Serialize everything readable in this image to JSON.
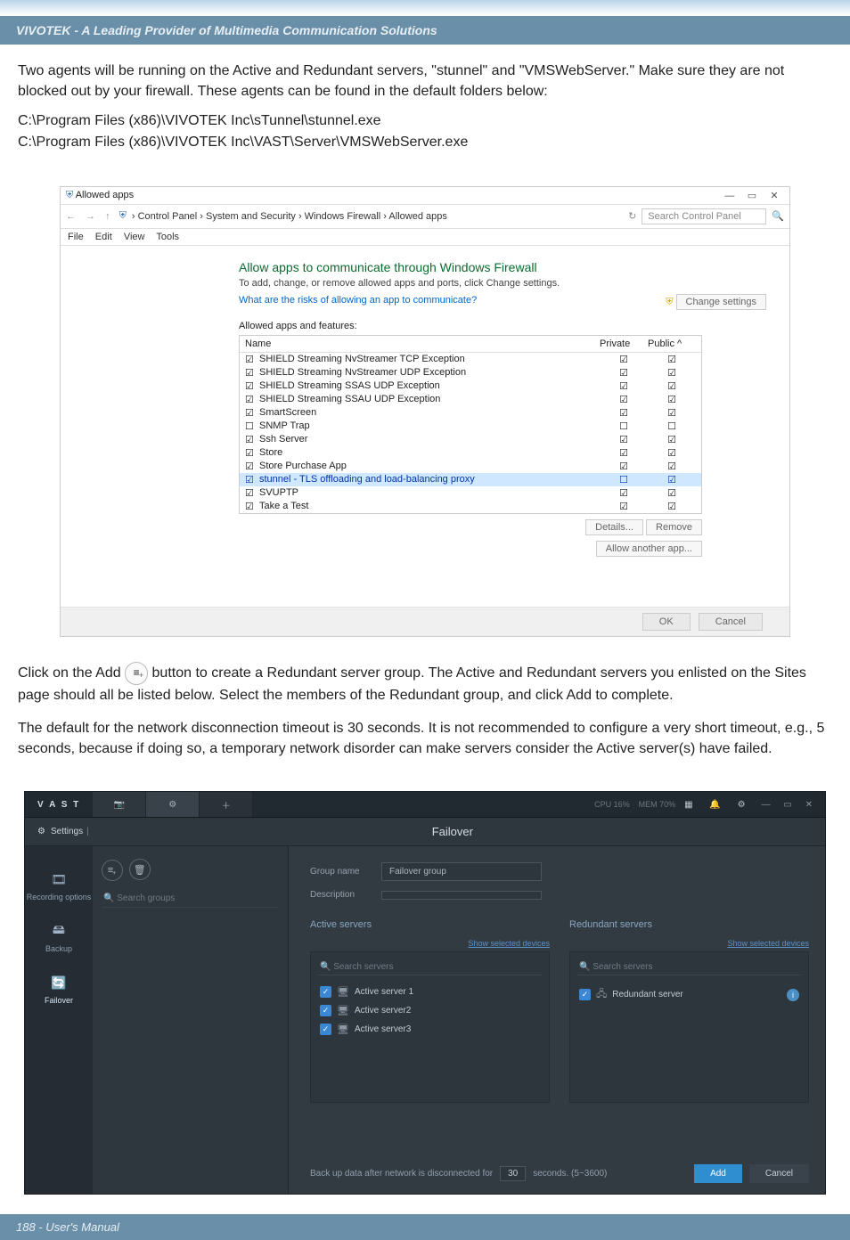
{
  "header": {
    "banner": "VIVOTEK - A Leading Provider of Multimedia Communication Solutions"
  },
  "intro": {
    "para1": "Two agents will be running on the Active and Redundant servers, \"stunnel\" and \"VMSWebServer.\" Make sure they are not blocked out by your firewall. These agents can be found in the default folders below:",
    "path1": "C:\\Program Files (x86)\\VIVOTEK Inc\\sTunnel\\stunnel.exe",
    "path2": "C:\\Program Files (x86)\\VIVOTEK Inc\\VAST\\Server\\VMSWebServer.exe"
  },
  "firewall": {
    "windowTitle": "Allowed apps",
    "breadcrumbs": "› Control Panel › System and Security › Windows Firewall › Allowed apps",
    "searchPlaceholder": "Search Control Panel",
    "menus": [
      "File",
      "Edit",
      "View",
      "Tools"
    ],
    "heading": "Allow apps to communicate through Windows Firewall",
    "subheading": "To add, change, or remove allowed apps and ports, click Change settings.",
    "risksLink": "What are the risks of allowing an app to communicate?",
    "changeSettings": "Change settings",
    "listLabel": "Allowed apps and features:",
    "colName": "Name",
    "colPrivate": "Private",
    "colPublic": "Public",
    "rows": [
      {
        "checked": true,
        "name": "SHIELD Streaming NvStreamer TCP Exception",
        "private": true,
        "public": true,
        "hl": false
      },
      {
        "checked": true,
        "name": "SHIELD Streaming NvStreamer UDP Exception",
        "private": true,
        "public": true,
        "hl": false
      },
      {
        "checked": true,
        "name": "SHIELD Streaming SSAS UDP Exception",
        "private": true,
        "public": true,
        "hl": false
      },
      {
        "checked": true,
        "name": "SHIELD Streaming SSAU UDP Exception",
        "private": true,
        "public": true,
        "hl": false
      },
      {
        "checked": true,
        "name": "SmartScreen",
        "private": true,
        "public": true,
        "hl": false
      },
      {
        "checked": false,
        "name": "SNMP Trap",
        "private": false,
        "public": false,
        "hl": false
      },
      {
        "checked": true,
        "name": "Ssh Server",
        "private": true,
        "public": true,
        "hl": false
      },
      {
        "checked": true,
        "name": "Store",
        "private": true,
        "public": true,
        "hl": false
      },
      {
        "checked": true,
        "name": "Store Purchase App",
        "private": true,
        "public": true,
        "hl": false
      },
      {
        "checked": true,
        "name": "stunnel - TLS offloading and load-balancing proxy",
        "private": false,
        "public": true,
        "hl": true
      },
      {
        "checked": true,
        "name": "SVUPTP",
        "private": true,
        "public": true,
        "hl": false
      },
      {
        "checked": true,
        "name": "Take a Test",
        "private": true,
        "public": true,
        "hl": false
      }
    ],
    "detailsBtn": "Details...",
    "removeBtn": "Remove",
    "allowAnother": "Allow another app...",
    "ok": "OK",
    "cancel": "Cancel"
  },
  "midtext": {
    "prefix": "Click on the Add ",
    "suffix": " button to create a Redundant server group. The Active and Redundant servers you enlisted on the Sites page should all be listed below. Select the members of the Redundant group, and click Add to complete.",
    "para2": "The default for the network disconnection timeout is 30 seconds. It is not recommended to configure a very short timeout, e.g., 5 seconds, because if doing so, a temporary network disorder can make servers consider the Active server(s) have failed."
  },
  "vast": {
    "logo": "V A S T",
    "cpu": "CPU 16%",
    "mem": "MEM 70%",
    "crumb": "Settings",
    "title": "Failover",
    "leftSearch": "Search groups",
    "sidenav": {
      "recording": "Recording options",
      "backup": "Backup",
      "failover": "Failover"
    },
    "form": {
      "groupNameLbl": "Group name",
      "groupNameVal": "Failover group",
      "descriptionLbl": "Description",
      "descriptionVal": ""
    },
    "panels": {
      "activeTitle": "Active servers",
      "redundantTitle": "Redundant servers",
      "showSelected": "Show selected devices",
      "searchServers": "Search servers",
      "activeServers": [
        "Active server 1",
        "Active server2",
        "Active server3"
      ],
      "redundantServers": [
        "Redundant server"
      ]
    },
    "bottom": {
      "backupPrefix": "Back up data after network is disconnected for",
      "value": "30",
      "suffix": "seconds. (5~3600)",
      "add": "Add",
      "cancel": "Cancel"
    }
  },
  "footer": {
    "text": "188 - User's Manual"
  }
}
